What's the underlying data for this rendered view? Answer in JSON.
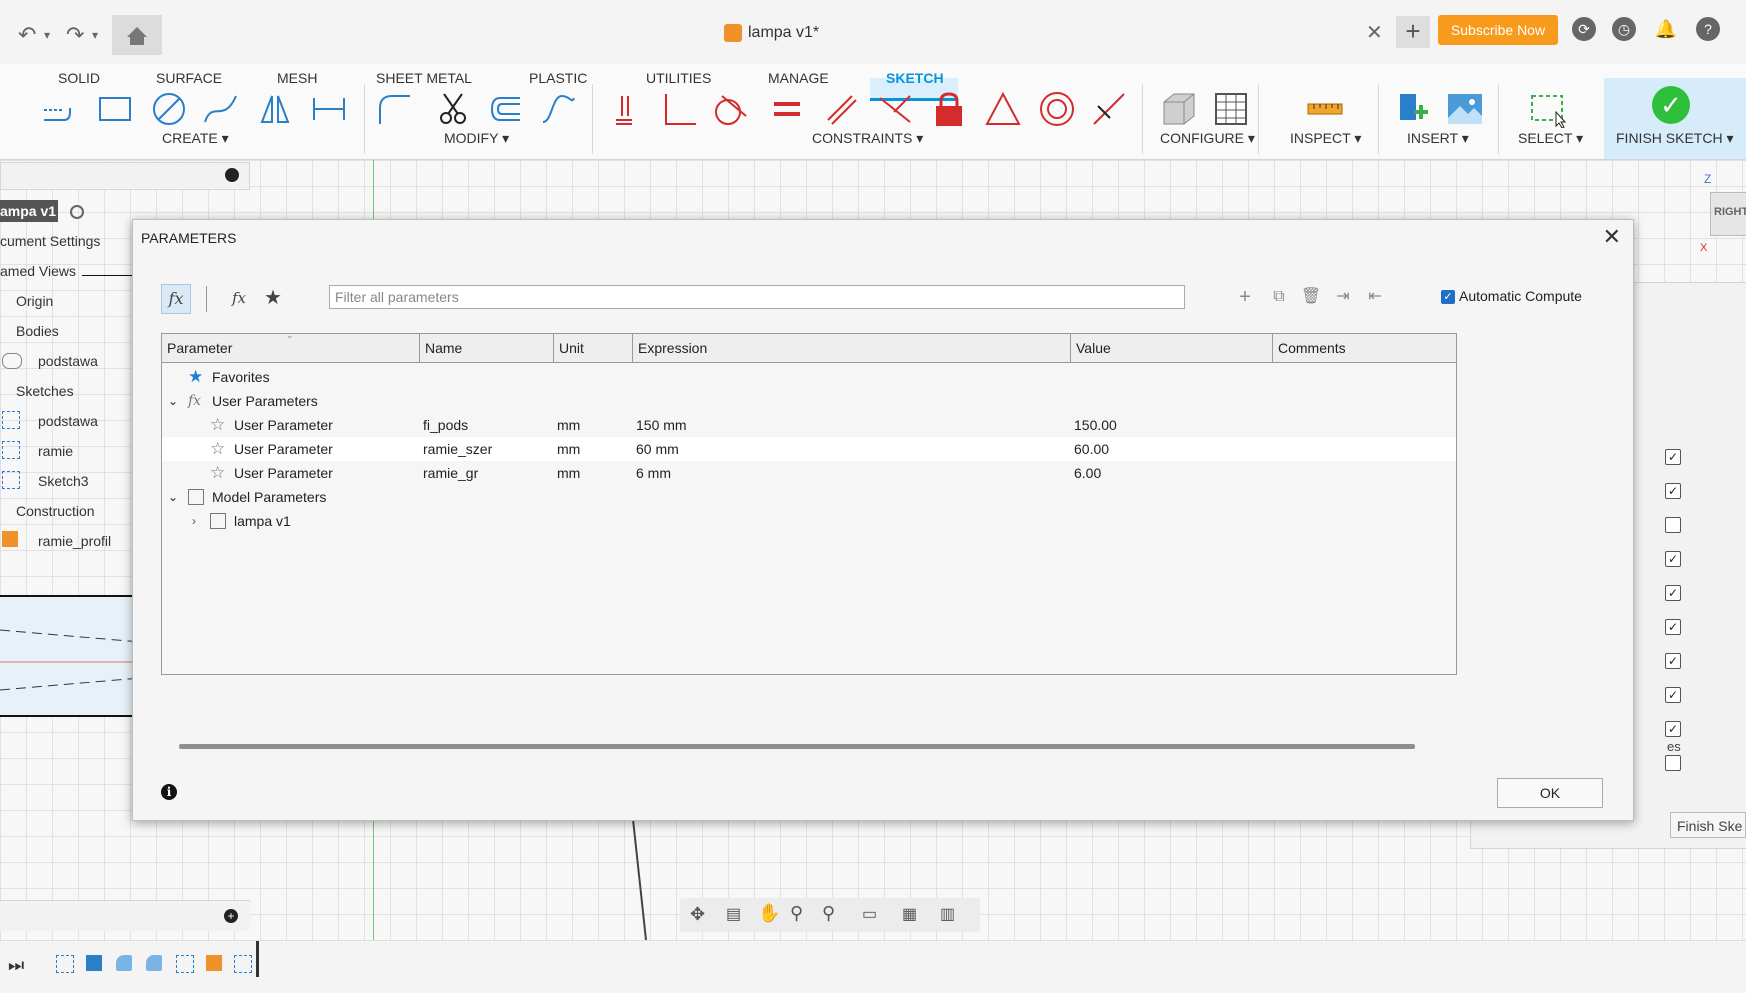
{
  "titlebar": {
    "doc_title": "lampa v1*",
    "subscribe_label": "Subscribe Now",
    "new_tab_label": "+",
    "close_tab_glyph": "✕"
  },
  "ribbon": {
    "tabs": [
      "SOLID",
      "SURFACE",
      "MESH",
      "SHEET METAL",
      "PLASTIC",
      "UTILITIES",
      "MANAGE",
      "SKETCH"
    ],
    "active_tab": "SKETCH",
    "groups": [
      "CREATE ▾",
      "MODIFY ▾",
      "CONSTRAINTS ▾",
      "CONFIGURE ▾",
      "INSPECT ▾",
      "INSERT ▾",
      "SELECT ▾",
      "FINISH SKETCH ▾"
    ]
  },
  "browser": {
    "root": "ampa v1",
    "items": [
      "cument Settings",
      "amed Views",
      "Origin",
      "Bodies",
      "podstawa",
      "Sketches",
      "podstawa",
      "ramie",
      "Sketch3",
      "Construction",
      "ramie_profil"
    ]
  },
  "canvas": {
    "view_label": "RIGHT",
    "axis_z": "Z",
    "axis_x": "X",
    "finish_sketch_short": "Finish Ske",
    "palette_fragment": "es",
    "checkboxes": [
      true,
      true,
      false,
      true,
      true,
      true,
      true,
      true,
      true,
      false
    ]
  },
  "dialog": {
    "title": "PARAMETERS",
    "filter_placeholder": "Filter all parameters",
    "automatic_compute_label": "Automatic Compute",
    "automatic_compute_checked": true,
    "columns": [
      "Parameter",
      "Name",
      "Unit",
      "Expression",
      "Value",
      "Comments"
    ],
    "favorites_label": "Favorites",
    "user_parameters_label": "User Parameters",
    "user_parameters": [
      {
        "parameter": "User Parameter",
        "name": "fi_pods",
        "unit": "mm",
        "expression": "150 mm",
        "value": "150.00",
        "comments": ""
      },
      {
        "parameter": "User Parameter",
        "name": "ramie_szer",
        "unit": "mm",
        "expression": "60 mm",
        "value": "60.00",
        "comments": ""
      },
      {
        "parameter": "User Parameter",
        "name": "ramie_gr",
        "unit": "mm",
        "expression": "6 mm",
        "value": "6.00",
        "comments": ""
      }
    ],
    "model_parameters_label": "Model Parameters",
    "model_child": "lampa v1",
    "ok_label": "OK",
    "fx_glyph": "fx"
  },
  "colors": {
    "accent": "#0696d7",
    "subscribe": "#f89a1c",
    "finish_check": "#2fbf3a",
    "fav_star": "#1f7fd4"
  }
}
